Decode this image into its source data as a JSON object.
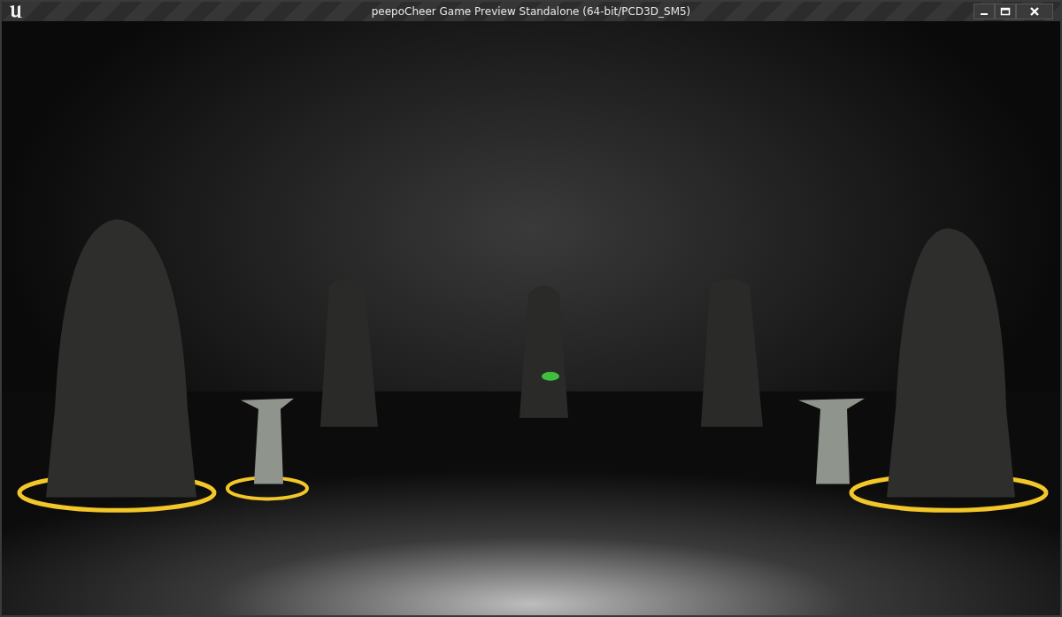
{
  "window": {
    "title": "peepoCheer Game Preview Standalone (64-bit/PCD3D_SM5)"
  }
}
